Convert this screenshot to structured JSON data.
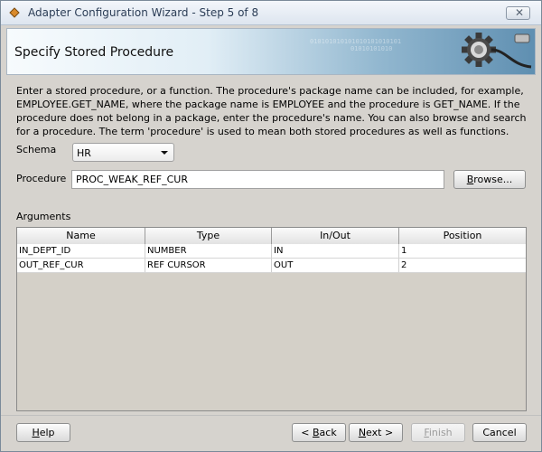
{
  "window": {
    "title": "Adapter Configuration Wizard - Step 5 of 8"
  },
  "banner": {
    "title": "Specify Stored Procedure",
    "binary": [
      "010101010101010101010101",
      "01010101010"
    ]
  },
  "description": "Enter a stored procedure, or a function. The procedure's package name can be included, for example, EMPLOYEE.GET_NAME, where the package name is EMPLOYEE and the procedure is GET_NAME.  If the procedure does not belong in a package, enter the procedure's name. You can also browse and search for a procedure. The term 'procedure' is used to mean both stored procedures as well as functions.",
  "schema": {
    "label": "Schema",
    "value": "HR"
  },
  "procedure": {
    "label": "Procedure",
    "value": "PROC_WEAK_REF_CUR"
  },
  "browse": {
    "label": "Browse...",
    "mnemonic": "B",
    "rest": "rowse..."
  },
  "arguments": {
    "label": "Arguments",
    "columns": [
      "Name",
      "Type",
      "In/Out",
      "Position"
    ],
    "rows": [
      [
        "IN_DEPT_ID",
        "NUMBER",
        "IN",
        "1"
      ],
      [
        "OUT_REF_CUR",
        "REF CURSOR",
        "OUT",
        "2"
      ]
    ]
  },
  "footer": {
    "help": {
      "mnemonic": "H",
      "rest": "elp"
    },
    "back": {
      "prefix": "< ",
      "mnemonic": "B",
      "rest": "ack"
    },
    "next": {
      "mnemonic": "N",
      "rest": "ext >"
    },
    "finish": {
      "mnemonic": "F",
      "rest": "inish"
    },
    "cancel": {
      "label": "Cancel"
    }
  }
}
